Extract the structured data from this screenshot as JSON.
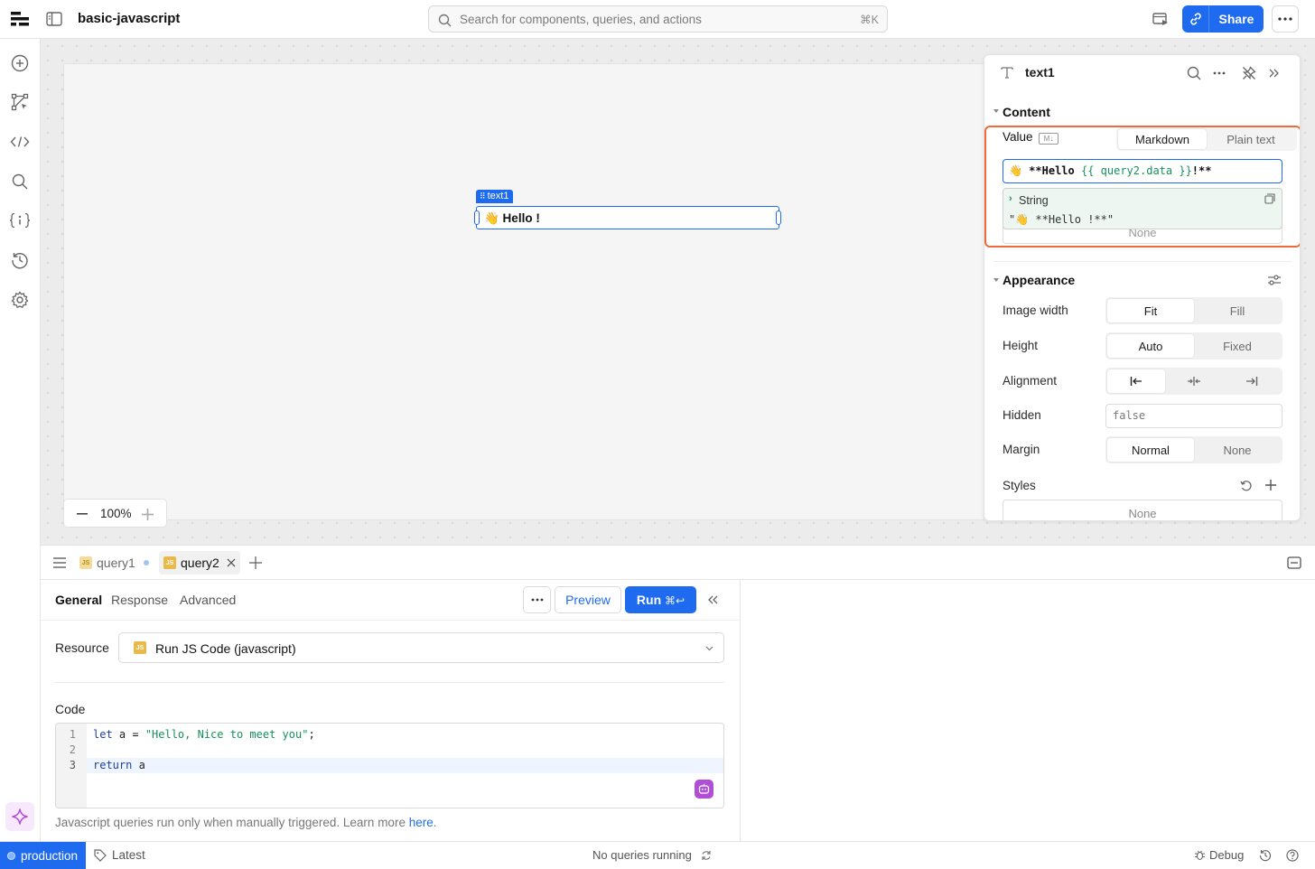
{
  "app": {
    "title": "basic-javascript"
  },
  "search": {
    "placeholder": "Search for components, queries, and actions",
    "shortcut": "⌘K"
  },
  "header": {
    "share_label": "Share"
  },
  "canvas": {
    "component_tag": "text1",
    "component_text": "👋 Hello !",
    "zoom": "100%"
  },
  "inspector": {
    "component_name": "text1",
    "content": {
      "section_title": "Content",
      "value_label": "Value",
      "md_badge": "M↓",
      "mode_markdown": "Markdown",
      "mode_plain": "Plain text",
      "value_prefix": "👋 **Hello ",
      "value_token": "{{ query2.data }}",
      "value_suffix": "!**",
      "eval_type": "String",
      "eval_value": "\"👋 **Hello !**\"",
      "behind_text": "None"
    },
    "appearance": {
      "section_title": "Appearance",
      "image_width_label": "Image width",
      "image_width_options": [
        "Fit",
        "Fill"
      ],
      "height_label": "Height",
      "height_options": [
        "Auto",
        "Fixed"
      ],
      "alignment_label": "Alignment",
      "hidden_label": "Hidden",
      "hidden_value": "false",
      "margin_label": "Margin",
      "margin_options": [
        "Normal",
        "None"
      ],
      "styles_label": "Styles",
      "styles_value": "None"
    }
  },
  "queries": {
    "tabs": [
      {
        "badge": "JS",
        "label": "query1"
      },
      {
        "badge": "JS",
        "label": "query2"
      }
    ],
    "subtabs": [
      "General",
      "Response",
      "Advanced"
    ],
    "preview_label": "Preview",
    "run_label": "Run",
    "run_shortcut": "⌘↩",
    "resource_label": "Resource",
    "resource_badge": "JS",
    "resource_value": "Run JS Code (javascript)",
    "code_label": "Code",
    "code_lines": [
      {
        "num": "1",
        "kw": "let",
        "rest": " a = ",
        "str": "\"Hello, Nice to meet you\"",
        "end": ";"
      },
      {
        "num": "2",
        "kw": "",
        "rest": "",
        "str": "",
        "end": ""
      },
      {
        "num": "3",
        "kw": "return",
        "rest": " a",
        "str": "",
        "end": ""
      }
    ],
    "help_text": "Javascript queries run only when manually triggered. Learn more ",
    "help_link": "here",
    "help_end": "."
  },
  "status": {
    "env": "production",
    "version": "Latest",
    "running": "No queries running",
    "debug": "Debug"
  },
  "colors": {
    "accent": "#1f6bf0",
    "highlight": "#ee6a3a",
    "js_badge": "#e9b949",
    "ai_purple": "#b04fd6"
  }
}
